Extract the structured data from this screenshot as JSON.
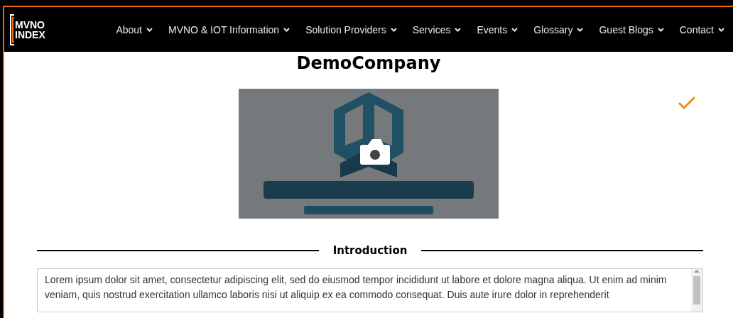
{
  "brand": {
    "line_1": "MVNO",
    "line_2": "INDEX"
  },
  "nav": [
    {
      "label": "About"
    },
    {
      "label": "MVNO & IOT Information"
    },
    {
      "label": "Solution Providers"
    },
    {
      "label": "Services"
    },
    {
      "label": "Events"
    },
    {
      "label": "Glossary"
    },
    {
      "label": "Guest Blogs"
    },
    {
      "label": "Contact"
    }
  ],
  "company": {
    "title": "DemoCompany",
    "verified": true
  },
  "section": {
    "heading": "Introduction"
  },
  "introduction": {
    "value": "Lorem ipsum dolor sit amet, consectetur adipiscing elit, sed do eiusmod tempor incididunt ut labore et dolore magna aliqua. Ut enim ad minim veniam, quis nostrud exercitation ullamco laboris nisi ut aliquip ex ea commodo consequat. Duis aute irure dolor in reprehenderit"
  }
}
